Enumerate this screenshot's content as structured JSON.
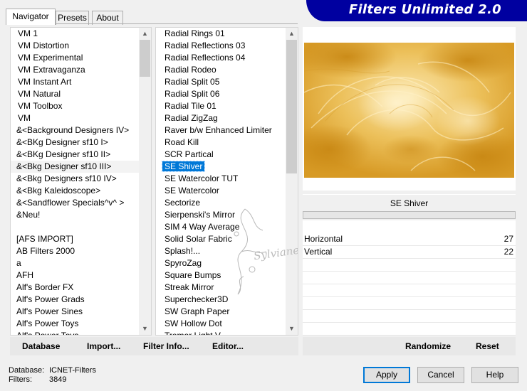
{
  "tabs": [
    {
      "label": "Navigator",
      "active": true
    },
    {
      "label": "Presets",
      "active": false
    },
    {
      "label": "About",
      "active": false
    }
  ],
  "banner": {
    "title": "Filters Unlimited 2.0",
    "color": "#0000a0"
  },
  "categories": [
    "VM 1",
    "VM Distortion",
    "VM Experimental",
    "VM Extravaganza",
    "VM Instant Art",
    "VM Natural",
    "VM Toolbox",
    "VM",
    "&<Background Designers IV>",
    "&<BKg Designer sf10 I>",
    "&<BKg Designer sf10 II>",
    "&<Bkg Designer sf10 III>",
    "&<Bkg Designers sf10 IV>",
    "&<Bkg Kaleidoscope>",
    "&<Sandflower Specials^v^ >",
    "&Neu!",
    "",
    "[AFS IMPORT]",
    "AB Filters 2000",
    "a",
    "AFH",
    "Alf's Border FX",
    "Alf's Power Grads",
    "Alf's Power Sines",
    "Alf's Power Toys",
    "Alf's Power Toys"
  ],
  "filters": [
    "Radial  Rings 01",
    "Radial Reflections 03",
    "Radial Reflections 04",
    "Radial Rodeo",
    "Radial Split 05",
    "Radial Split 06",
    "Radial Tile 01",
    "Radial ZigZag",
    "Raver b/w Enhanced Limiter",
    "Road Kill",
    "SCR  Partical",
    "SE Shiver",
    "SE Watercolor TUT",
    "SE Watercolor",
    "Sectorize",
    "Sierpenski's Mirror",
    "SIM 4 Way Average",
    "Solid Solar Fabric",
    "Splash!...",
    "SpyroZag",
    "Square Bumps",
    "Streak Mirror",
    "Superchecker3D",
    "SW Graph Paper",
    "SW Hollow Dot",
    "Tremor Light V..."
  ],
  "selected_filter": "SE Shiver",
  "filter_title": "SE Shiver",
  "params": [
    {
      "label": "Horizontal",
      "value": "27"
    },
    {
      "label": "Vertical",
      "value": "22"
    }
  ],
  "watermark": "Sylviane",
  "left_buttons": {
    "database": "Database",
    "import": "Import...",
    "filter_info": "Filter Info...",
    "editor": "Editor..."
  },
  "right_buttons": {
    "randomize": "Randomize",
    "reset": "Reset"
  },
  "info": {
    "database_label": "Database:",
    "database_value": "ICNET-Filters",
    "filters_label": "Filters:",
    "filters_value": "3849"
  },
  "dialog_buttons": {
    "apply": "Apply",
    "cancel": "Cancel",
    "help": "Help"
  },
  "colors": {
    "selection": "#0078d7",
    "preview_gold": "#e2ad3a"
  }
}
